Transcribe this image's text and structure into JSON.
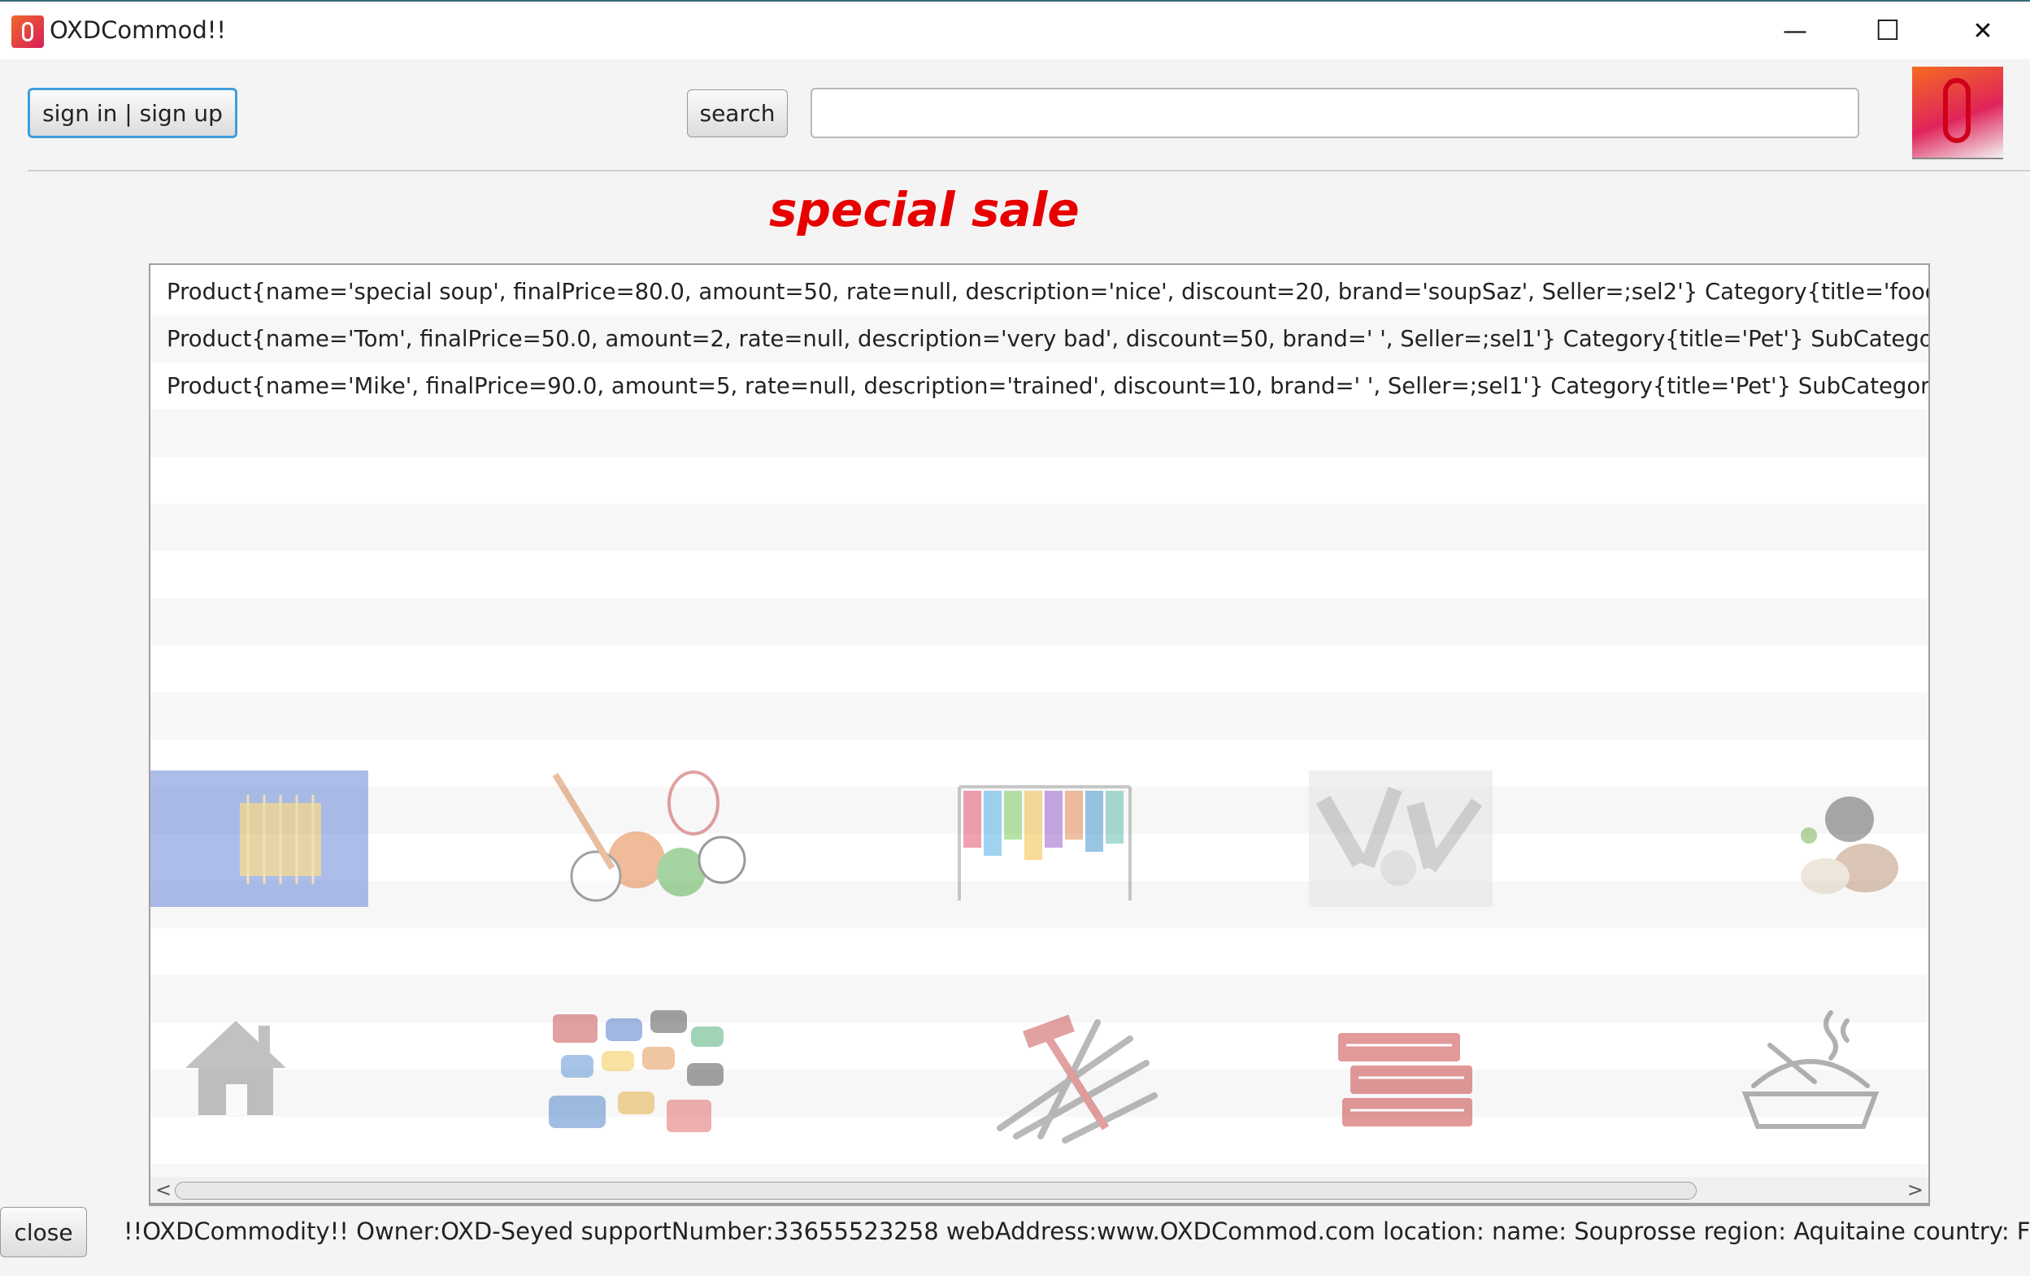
{
  "window": {
    "title": "OXDCommod!!",
    "minimize": "—",
    "maximize": "☐",
    "close": "✕"
  },
  "toolbar": {
    "signin_label": "sign in | sign up",
    "search_label": "search",
    "search_value": "",
    "logo_text": "OXD"
  },
  "special_sale": {
    "heading": "special sale"
  },
  "products": [
    "Product{name='special soup', finalPrice=80.0, amount=50, rate=null, description='nice', discount=20, brand='soupSaz', Seller=;sel2'} Category{title='food'}  SubCategory{subTitle=",
    "Product{name='Tom', finalPrice=50.0, amount=2, rate=null, description='very bad', discount=50, brand='   ', Seller=;sel1'} Category{title='Pet'}  SubCategory{subTitle=",
    "Product{name='Mike', finalPrice=90.0, amount=5, rate=null, description='trained', discount=10, brand='   ', Seller=;sel1'} Category{title='Pet'}  SubCategory{subTitle="
  ],
  "categories": [
    {
      "icon": "electronics-chip-icon"
    },
    {
      "icon": "sports-balls-icon"
    },
    {
      "icon": "clothes-rack-icon"
    },
    {
      "icon": "cosmetics-icon"
    },
    {
      "icon": "pets-icon"
    },
    {
      "icon": "home-icon"
    },
    {
      "icon": "vehicles-icon"
    },
    {
      "icon": "tools-icon"
    },
    {
      "icon": "books-icon"
    },
    {
      "icon": "food-bowl-icon"
    }
  ],
  "footer": {
    "close_label": "close",
    "info": "!!OXDCommodity!!  Owner:OXD-Seyed supportNumber:33655523258 webAddress:www.OXDCommod.com location: name: Souprosse region: Aquitaine country: France"
  }
}
